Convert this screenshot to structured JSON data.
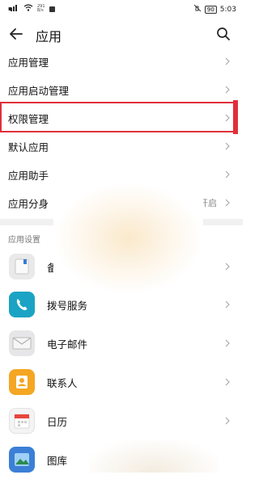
{
  "status": {
    "speed": "291\nB/s",
    "battery": "90",
    "time": "5:03"
  },
  "header": {
    "title": "应用"
  },
  "menu": [
    {
      "label": "应用管理"
    },
    {
      "label": "应用启动管理"
    },
    {
      "label": "权限管理"
    },
    {
      "label": "默认应用"
    },
    {
      "label": "应用助手"
    },
    {
      "label": "应用分身",
      "value": "开启"
    }
  ],
  "section_title": "应用设置",
  "apps": [
    {
      "label": "备",
      "icon": "memo-icon"
    },
    {
      "label": "拨号服务",
      "icon": "phone-icon"
    },
    {
      "label": "电子邮件",
      "icon": "email-icon"
    },
    {
      "label": "联系人",
      "icon": "contacts-icon"
    },
    {
      "label": "日历",
      "icon": "calendar-icon"
    },
    {
      "label": "图库",
      "icon": "gallery-icon"
    }
  ],
  "colors": {
    "highlight": "#e0303a",
    "phone": "#1aa3c4",
    "contacts": "#f5a623",
    "calendar": "#e8463c"
  }
}
